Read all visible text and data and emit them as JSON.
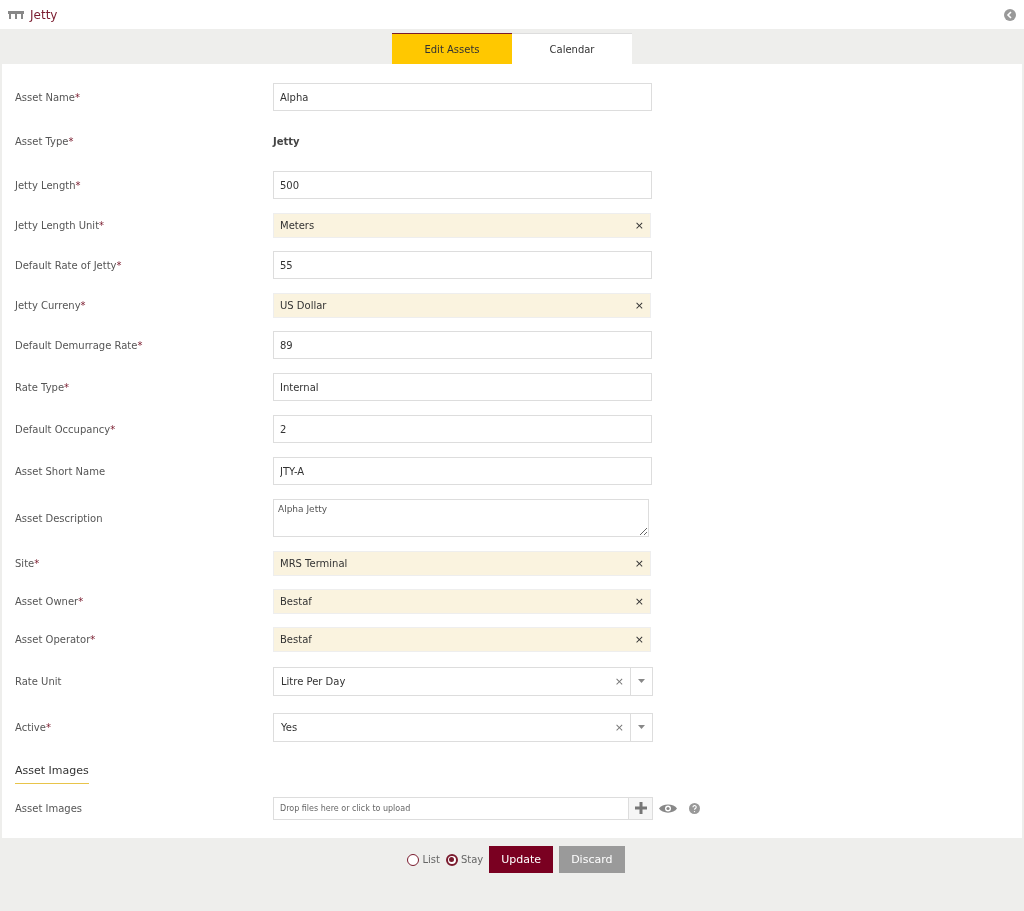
{
  "header": {
    "title": "Jetty"
  },
  "tabs": [
    {
      "label": "Edit Assets",
      "selected": true
    },
    {
      "label": "Calendar",
      "selected": false
    }
  ],
  "fields": [
    {
      "label": "Asset Name",
      "required_mark": "*",
      "kind": "input",
      "value": "Alpha"
    },
    {
      "label": "Asset Type",
      "required_mark": "*",
      "kind": "static",
      "value": "Jetty"
    },
    {
      "label": "Jetty Length",
      "required_mark": "*",
      "kind": "input",
      "value": "500"
    },
    {
      "label": "Jetty Length Unit",
      "required_mark": "*",
      "kind": "chip",
      "value": "Meters",
      "clear": "×"
    },
    {
      "label": "Default Rate of Jetty",
      "required_mark": "*",
      "kind": "input",
      "value": "55"
    },
    {
      "label": "Jetty Curreny",
      "required_mark": "*",
      "kind": "chip",
      "value": "US Dollar",
      "clear": "×"
    },
    {
      "label": "Default Demurrage Rate",
      "required_mark": "*",
      "kind": "input",
      "value": "89"
    },
    {
      "label": "Rate Type",
      "required_mark": "*",
      "kind": "input",
      "value": "Internal"
    },
    {
      "label": "Default Occupancy",
      "required_mark": "*",
      "kind": "input",
      "value": "2"
    },
    {
      "label": "Asset Short Name",
      "kind": "input",
      "value": "JTY-A"
    },
    {
      "label": "Asset Description",
      "kind": "textarea",
      "value": "Alpha Jetty"
    },
    {
      "label": "Site",
      "required_mark": "*",
      "kind": "chip",
      "value": "MRS Terminal",
      "clear": "×"
    },
    {
      "label": "Asset Owner",
      "required_mark": "*",
      "kind": "chip",
      "value": "Bestaf",
      "clear": "×"
    },
    {
      "label": "Asset Operator",
      "required_mark": "*",
      "kind": "chip",
      "value": "Bestaf",
      "clear": "×"
    },
    {
      "label": "Rate Unit",
      "kind": "select",
      "value": "Litre Per Day",
      "clear": "×"
    },
    {
      "label": "Active",
      "required_mark": "*",
      "kind": "select",
      "value": "Yes",
      "clear": "×"
    }
  ],
  "images_section": {
    "heading": "Asset Images",
    "label": "Asset Images",
    "placeholder": "Drop files here or click to upload"
  },
  "after_save": [
    {
      "label": "List",
      "selected": false
    },
    {
      "label": "Stay",
      "selected": true
    }
  ],
  "buttons": {
    "update": "Update",
    "discard": "Discard"
  }
}
